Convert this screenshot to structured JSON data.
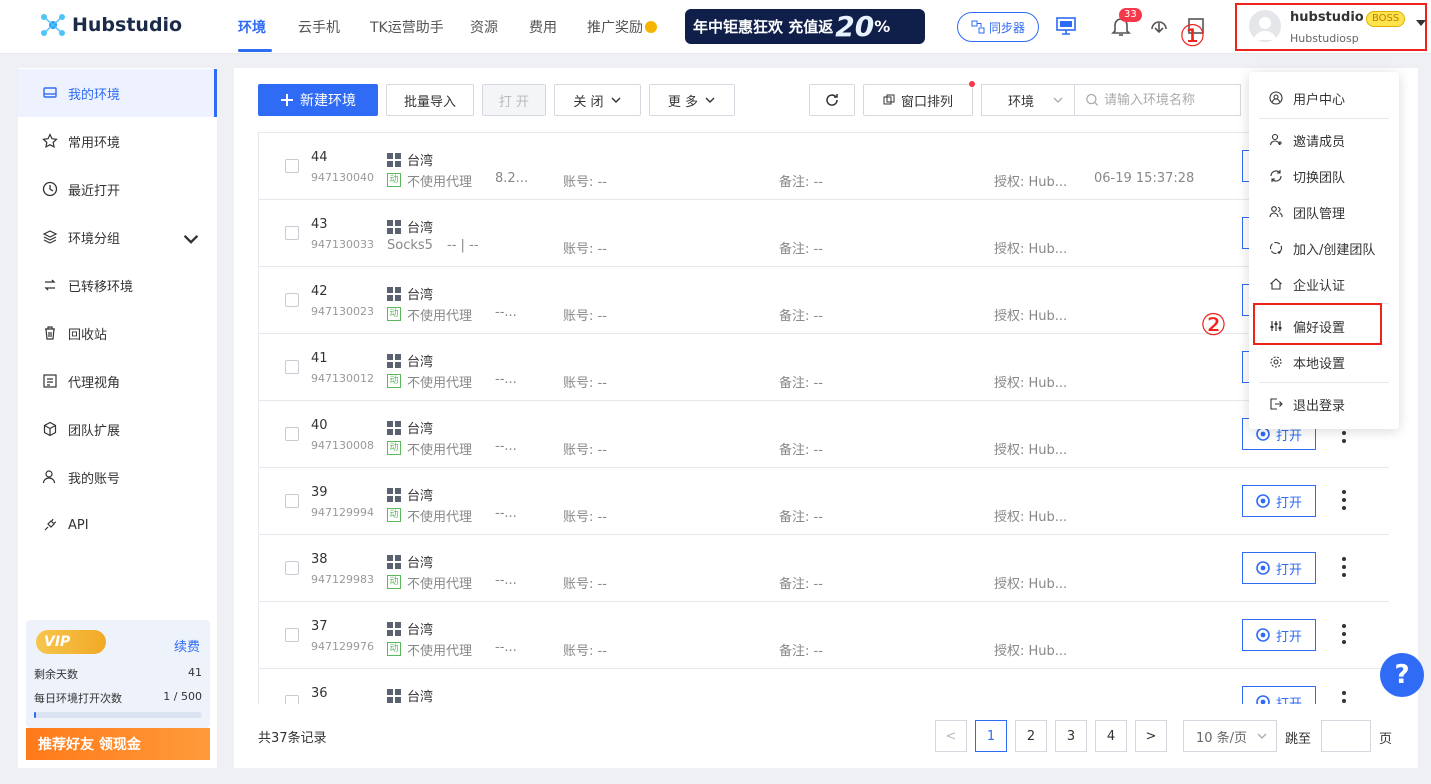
{
  "app": {
    "logo": "Hubstudio"
  },
  "nav": {
    "items": [
      "环境",
      "云手机",
      "TK运营助手",
      "资源",
      "费用",
      "推广奖励"
    ],
    "active": "环境"
  },
  "banner": {
    "text": "年中钜惠狂欢 充值返",
    "big": "20",
    "unit": "%"
  },
  "toolbar_top": {
    "sync": "同步器",
    "notifications": "33"
  },
  "user": {
    "name": "hubstudio",
    "role": "BOSS",
    "account": "Hubstudiosp"
  },
  "annotations": {
    "one": "①",
    "two": "②"
  },
  "sidebar": {
    "items": [
      {
        "label": "我的环境",
        "icon": "monitor-icon"
      },
      {
        "label": "常用环境",
        "icon": "star-icon"
      },
      {
        "label": "最近打开",
        "icon": "clock-icon"
      },
      {
        "label": "环境分组",
        "icon": "layers-icon"
      },
      {
        "label": "已转移环境",
        "icon": "transfer-icon"
      },
      {
        "label": "回收站",
        "icon": "trash-icon"
      },
      {
        "label": "代理视角",
        "icon": "list-icon"
      },
      {
        "label": "团队扩展",
        "icon": "cube-icon"
      },
      {
        "label": "我的账号",
        "icon": "user-icon"
      },
      {
        "label": "API",
        "icon": "plug-icon"
      }
    ],
    "vip": {
      "badge": "VIP",
      "renew": "续费",
      "days_label": "剩余天数",
      "days_value": "41",
      "opens_label": "每日环境打开次数",
      "opens_value": "1 / 500",
      "progress": 0.002
    },
    "refer": "推荐好友 领现金"
  },
  "toolbar": {
    "new": "新建环境",
    "import": "批量导入",
    "open": "打 开",
    "close": "关 闭",
    "more": "更 多",
    "arrange": "窗口排列",
    "search_scope": "环境",
    "search_placeholder": "请输入环境名称"
  },
  "rows": [
    {
      "id": "44",
      "serial": "947130040",
      "region": "台湾",
      "proxy_tag": "动",
      "proxy": "不使用代理",
      "ip": "8.2...",
      "account": "账号: --",
      "note": "备注: --",
      "auth": "授权: Hub...",
      "time": "06-19 15:37:28",
      "open": "打开"
    },
    {
      "id": "43",
      "serial": "947130033",
      "region": "台湾",
      "proxy_tag": "",
      "proxy": "Socks5",
      "ip": "--  |  --",
      "account": "账号: --",
      "note": "备注: --",
      "auth": "授权: Hub...",
      "time": "",
      "open": "打开"
    },
    {
      "id": "42",
      "serial": "947130023",
      "region": "台湾",
      "proxy_tag": "动",
      "proxy": "不使用代理",
      "ip": "--...",
      "account": "账号: --",
      "note": "备注: --",
      "auth": "授权: Hub...",
      "time": "",
      "open": "打开"
    },
    {
      "id": "41",
      "serial": "947130012",
      "region": "台湾",
      "proxy_tag": "动",
      "proxy": "不使用代理",
      "ip": "--...",
      "account": "账号: --",
      "note": "备注: --",
      "auth": "授权: Hub...",
      "time": "",
      "open": "打开"
    },
    {
      "id": "40",
      "serial": "947130008",
      "region": "台湾",
      "proxy_tag": "动",
      "proxy": "不使用代理",
      "ip": "--...",
      "account": "账号: --",
      "note": "备注: --",
      "auth": "授权: Hub...",
      "time": "",
      "open": "打开"
    },
    {
      "id": "39",
      "serial": "947129994",
      "region": "台湾",
      "proxy_tag": "动",
      "proxy": "不使用代理",
      "ip": "--...",
      "account": "账号: --",
      "note": "备注: --",
      "auth": "授权: Hub...",
      "time": "",
      "open": "打开"
    },
    {
      "id": "38",
      "serial": "947129983",
      "region": "台湾",
      "proxy_tag": "动",
      "proxy": "不使用代理",
      "ip": "--...",
      "account": "账号: --",
      "note": "备注: --",
      "auth": "授权: Hub...",
      "time": "",
      "open": "打开"
    },
    {
      "id": "37",
      "serial": "947129976",
      "region": "台湾",
      "proxy_tag": "动",
      "proxy": "不使用代理",
      "ip": "--...",
      "account": "账号: --",
      "note": "备注: --",
      "auth": "授权: Hub...",
      "time": "",
      "open": "打开"
    },
    {
      "id": "36",
      "serial": "",
      "region": "台湾",
      "proxy_tag": "",
      "proxy": "",
      "ip": "",
      "account": "",
      "note": "",
      "auth": "",
      "time": "",
      "open": "打开"
    }
  ],
  "footer": {
    "total": "共37条记录",
    "pages": [
      "1",
      "2",
      "3",
      "4"
    ],
    "prev": "<",
    "next": ">",
    "page_size": "10 条/页",
    "jump": "跳至",
    "page_unit": "页"
  },
  "dropdown": {
    "items": [
      "用户中心",
      "邀请成员",
      "切换团队",
      "团队管理",
      "加入/创建团队",
      "企业认证",
      "偏好设置",
      "本地设置",
      "退出登录"
    ]
  },
  "help": "?",
  "colors": {
    "accent": "#2f6bf5",
    "annotation": "#f0221c"
  }
}
